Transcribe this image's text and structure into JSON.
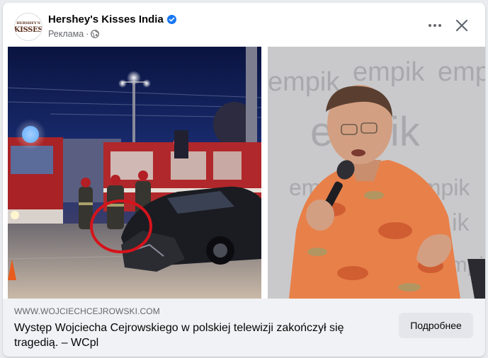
{
  "post": {
    "page_name": "Hershey's Kisses India",
    "avatar_logo_text": "KISSES",
    "avatar_logo_small": "HERSHEY'S",
    "sponsored_label": "Реклама",
    "meta_separator": "·",
    "icons": {
      "verified": "verified-badge-icon",
      "audience": "globe-icon",
      "more": "more-options-icon",
      "close": "close-icon"
    },
    "colors": {
      "verified": "#1877f2",
      "link_bg": "#f0f2f5",
      "button_bg": "#e4e6eb"
    }
  },
  "link": {
    "domain": "WWW.WOJCIECHCEJROWSKI.COM",
    "title": "Występ Wojciecha Cejrowskiego w polskiej telewizji zakończył się tragedią. – WCpl",
    "button_label": "Подробнее"
  },
  "images": {
    "left_text": "",
    "right_background_words": [
      "empik",
      "empik",
      "empik",
      "empik",
      "empik",
      "empik",
      "ik",
      "empik"
    ]
  }
}
